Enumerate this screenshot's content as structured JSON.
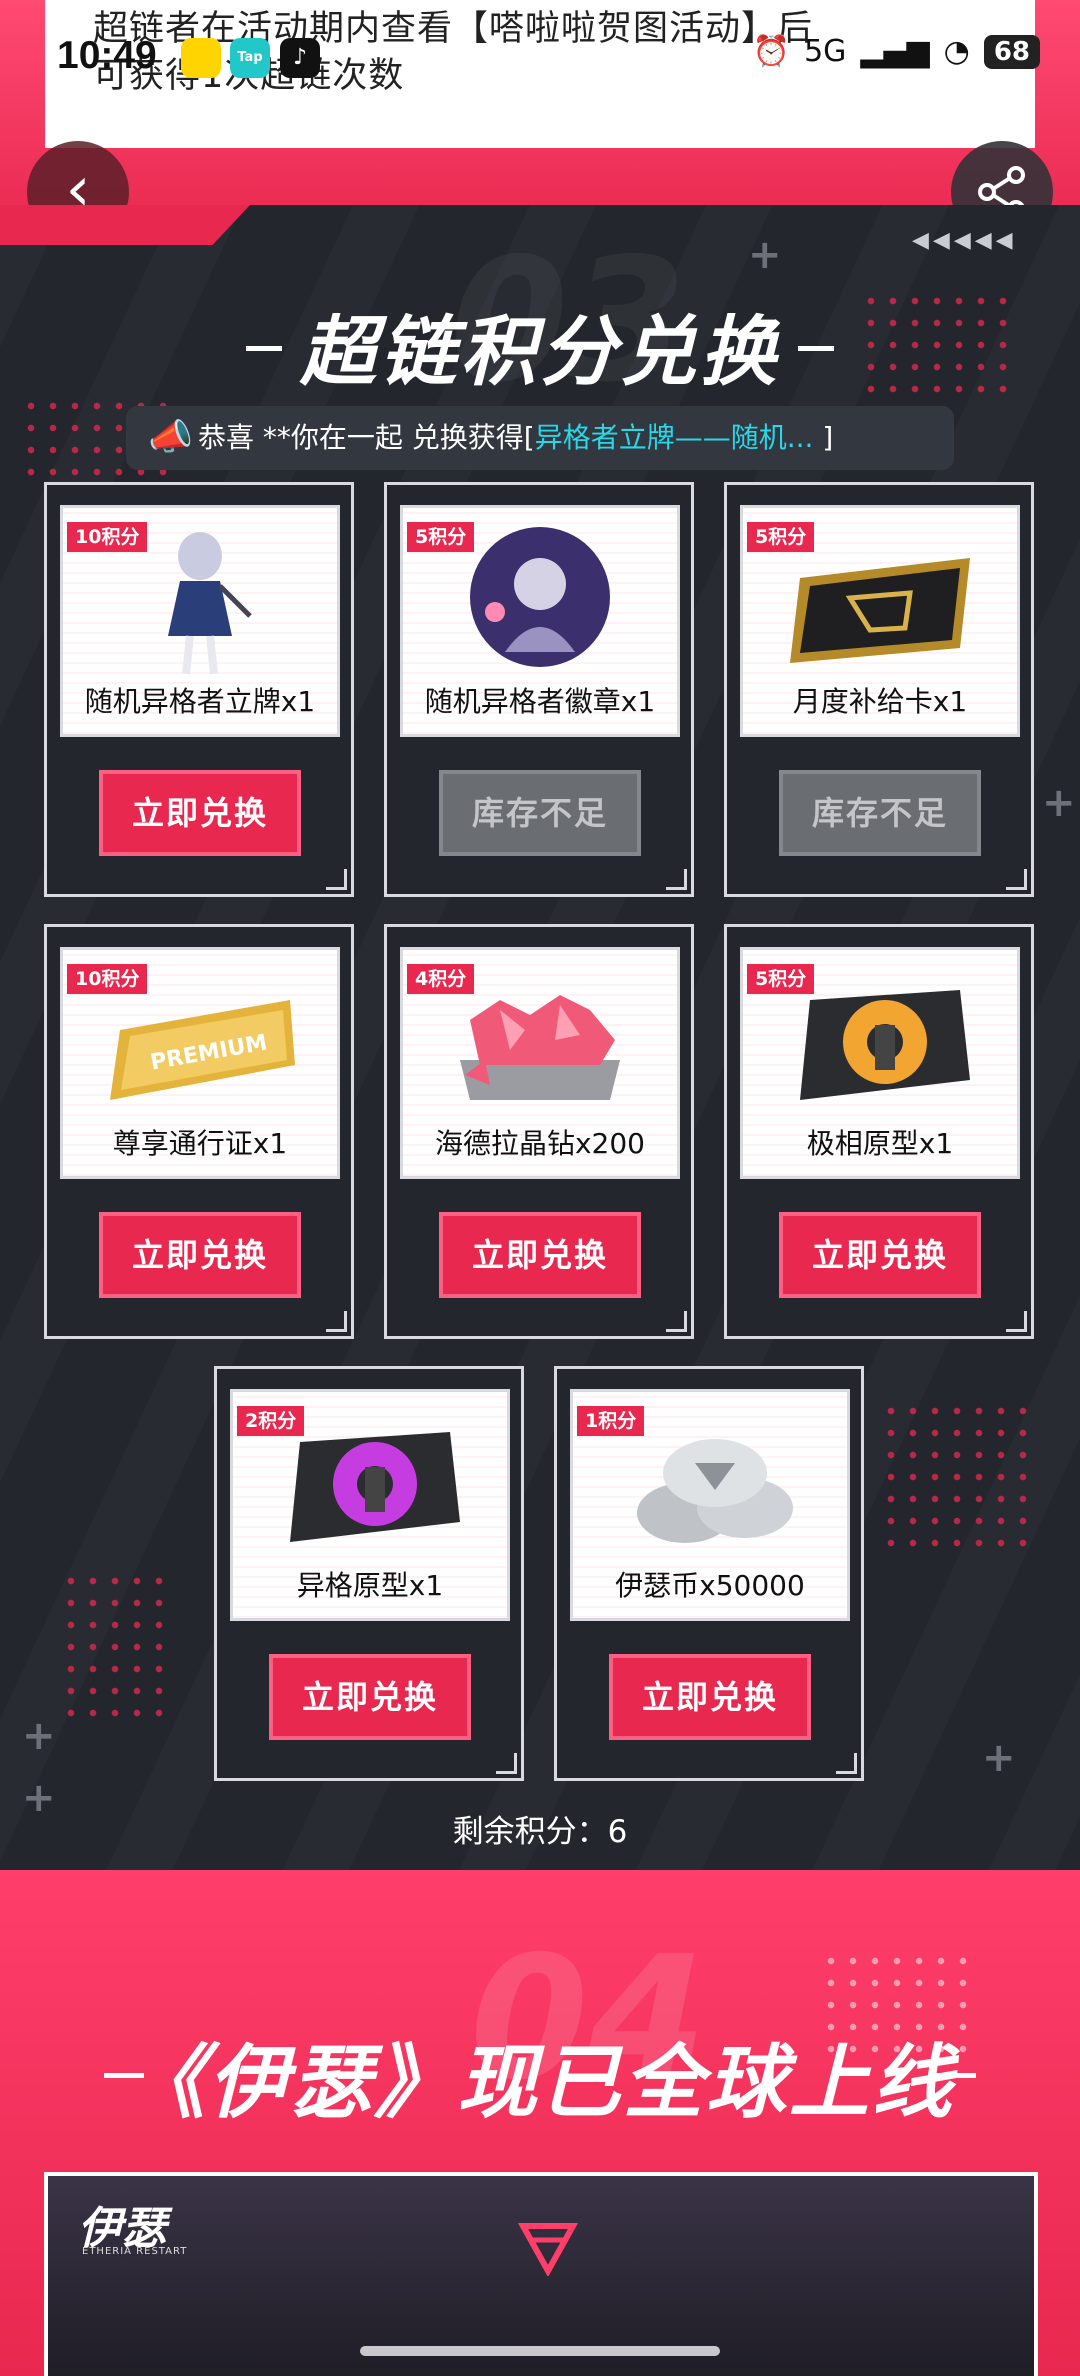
{
  "status_bar": {
    "time": "10:49",
    "icons": [
      "app-a-icon",
      "taptap-icon",
      "tiktok-icon"
    ],
    "tap_label": "Tap",
    "network": "5G",
    "carrier_icon_text": "",
    "battery": "68"
  },
  "top_banner": {
    "text": "超链者在活动期内查看【嗒啦啦贺图活动】后可获得1次超链次数"
  },
  "section": {
    "deco_number": "03",
    "title": "超链积分兑换",
    "notice_prefix": "恭喜 **你在一起 兑换获得[",
    "notice_item": "异格者立牌——随机...",
    "notice_suffix": "]"
  },
  "cards": [
    {
      "points": "10积分",
      "name": "随机异格者立牌x1",
      "button": "立即兑换",
      "available": true
    },
    {
      "points": "5积分",
      "name": "随机异格者徽章x1",
      "button": "库存不足",
      "available": false
    },
    {
      "points": "5积分",
      "name": "月度补给卡x1",
      "button": "库存不足",
      "available": false
    },
    {
      "points": "10积分",
      "name": "尊享通行证x1",
      "button": "立即兑换",
      "available": true
    },
    {
      "points": "4积分",
      "name": "海德拉晶钻x200",
      "button": "立即兑换",
      "available": true
    },
    {
      "points": "5积分",
      "name": "极相原型x1",
      "button": "立即兑换",
      "available": true
    },
    {
      "points": "2积分",
      "name": "异格原型x1",
      "button": "立即兑换",
      "available": true
    },
    {
      "points": "1积分",
      "name": "伊瑟币x50000",
      "button": "立即兑换",
      "available": true
    }
  ],
  "remaining": "剩余积分：6",
  "section2": {
    "deco_number": "04",
    "title": "《伊瑟》现已全球上线"
  },
  "game_banner": {
    "logo": "伊瑟",
    "logo_sub": "ETHERIA RESTART"
  },
  "colors": {
    "accent": "#e8284f",
    "panel": "#23272d",
    "highlight": "#29d7e6",
    "disabled": "#6a6d72"
  }
}
